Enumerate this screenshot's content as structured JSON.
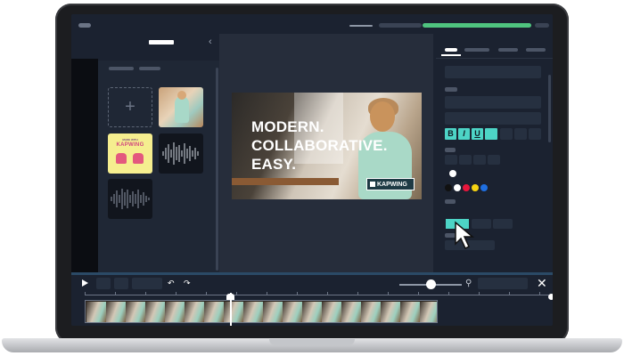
{
  "canvas": {
    "headline_lines": [
      "MODERN.",
      "COLLABORATIVE.",
      "EASY."
    ],
    "badge_label": "KAPWING"
  },
  "media_panel": {
    "add_symbol": "+",
    "collapse_symbol": "‹",
    "sticker_small_text": "MADE WITH",
    "sticker_big_text": "KAPWING"
  },
  "text_format": {
    "bold": "B",
    "italic": "I",
    "underline": "U"
  },
  "swatches": [
    "#ffffff",
    "#111111",
    "#ffffff",
    "#e8163c",
    "#f5d312",
    "#1f6fe0"
  ],
  "timeline": {
    "undo_symbol": "↶",
    "redo_symbol": "↷",
    "zoom_symbol": "⚲",
    "close_symbol": "✕",
    "zoom_level": 0.5
  },
  "colors": {
    "accent": "#4dd4c6",
    "progress_green": "#4fc47f",
    "panel_bg": "#1b2230",
    "canvas_bg": "#262d3b"
  }
}
